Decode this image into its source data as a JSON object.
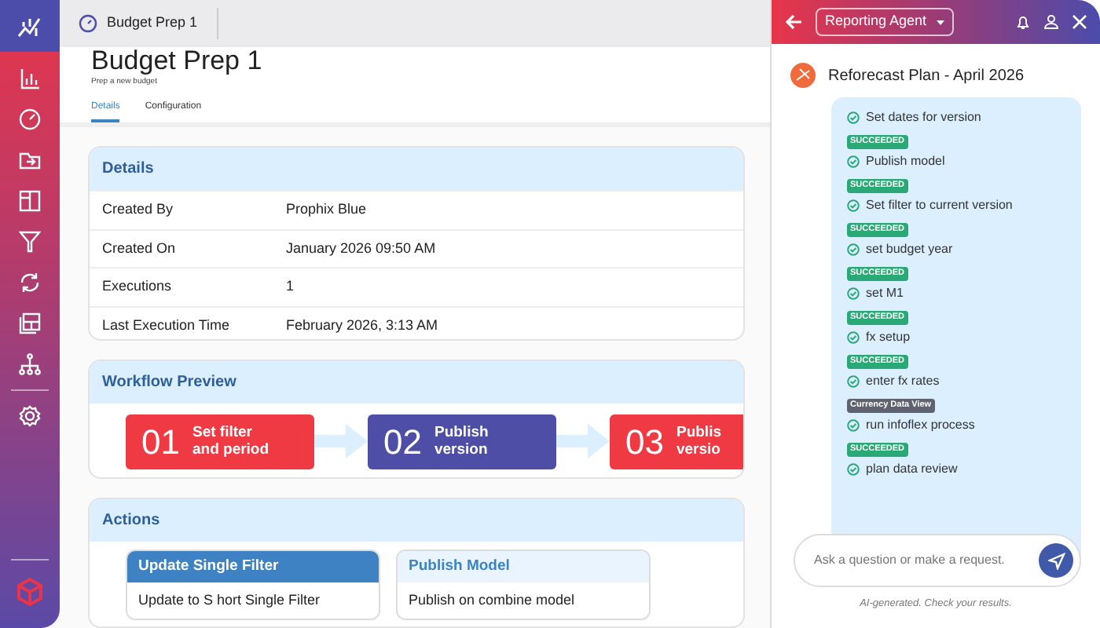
{
  "doc_tab": {
    "label": "Budget Prep 1"
  },
  "header": {
    "title": "Budget Prep 1",
    "subtitle": "Prep a new budget"
  },
  "tabs": [
    {
      "label": "Details",
      "selected": true
    },
    {
      "label": "Configuration",
      "selected": false
    }
  ],
  "details": {
    "title": "Details",
    "rows": [
      {
        "label": "Created By",
        "value": "Prophix Blue"
      },
      {
        "label": "Created On",
        "value": "January 2026 09:50 AM"
      },
      {
        "label": "Executions",
        "value": "1"
      },
      {
        "label": "Last Execution Time",
        "value": "February 2026, 3:13 AM"
      }
    ]
  },
  "workflow": {
    "title": "Workflow Preview",
    "steps": [
      {
        "number": "01",
        "label": "Set filter and period",
        "color": "#ef3a44"
      },
      {
        "number": "02",
        "label": "Publish version",
        "color": "#4e4ea7"
      },
      {
        "number": "03",
        "label": "Publis versio",
        "color": "#ef3a44"
      }
    ]
  },
  "actions": {
    "title": "Actions",
    "items": [
      {
        "title": "Update Single Filter",
        "description": "Update to S hort Single Filter",
        "selected": true
      },
      {
        "title": "Publish Model",
        "description": "Publish on combine model",
        "selected": false
      }
    ]
  },
  "agent": {
    "selector": "Reporting Agent",
    "plan_title": "Reforecast Plan - April 2026",
    "tasks": [
      {
        "label": "Set dates for version",
        "badge": "SUCCEEDED",
        "kind": "success"
      },
      {
        "label": "Publish model",
        "badge": "SUCCEEDED",
        "kind": "success"
      },
      {
        "label": "Set filter to current version",
        "badge": "SUCCEEDED",
        "kind": "success"
      },
      {
        "label": "set budget year",
        "badge": "SUCCEEDED",
        "kind": "success"
      },
      {
        "label": "set M1",
        "badge": "SUCCEEDED",
        "kind": "success"
      },
      {
        "label": "fx setup",
        "badge": "SUCCEEDED",
        "kind": "success"
      },
      {
        "label": "enter fx rates",
        "badge": "Currency Data View",
        "kind": "view"
      },
      {
        "label": "run infoflex process",
        "badge": "SUCCEEDED",
        "kind": "success"
      },
      {
        "label": "plan data review"
      }
    ],
    "input": {
      "placeholder": "Ask a question or make a request."
    },
    "disclaimer": "AI-generated. Check your results."
  }
}
